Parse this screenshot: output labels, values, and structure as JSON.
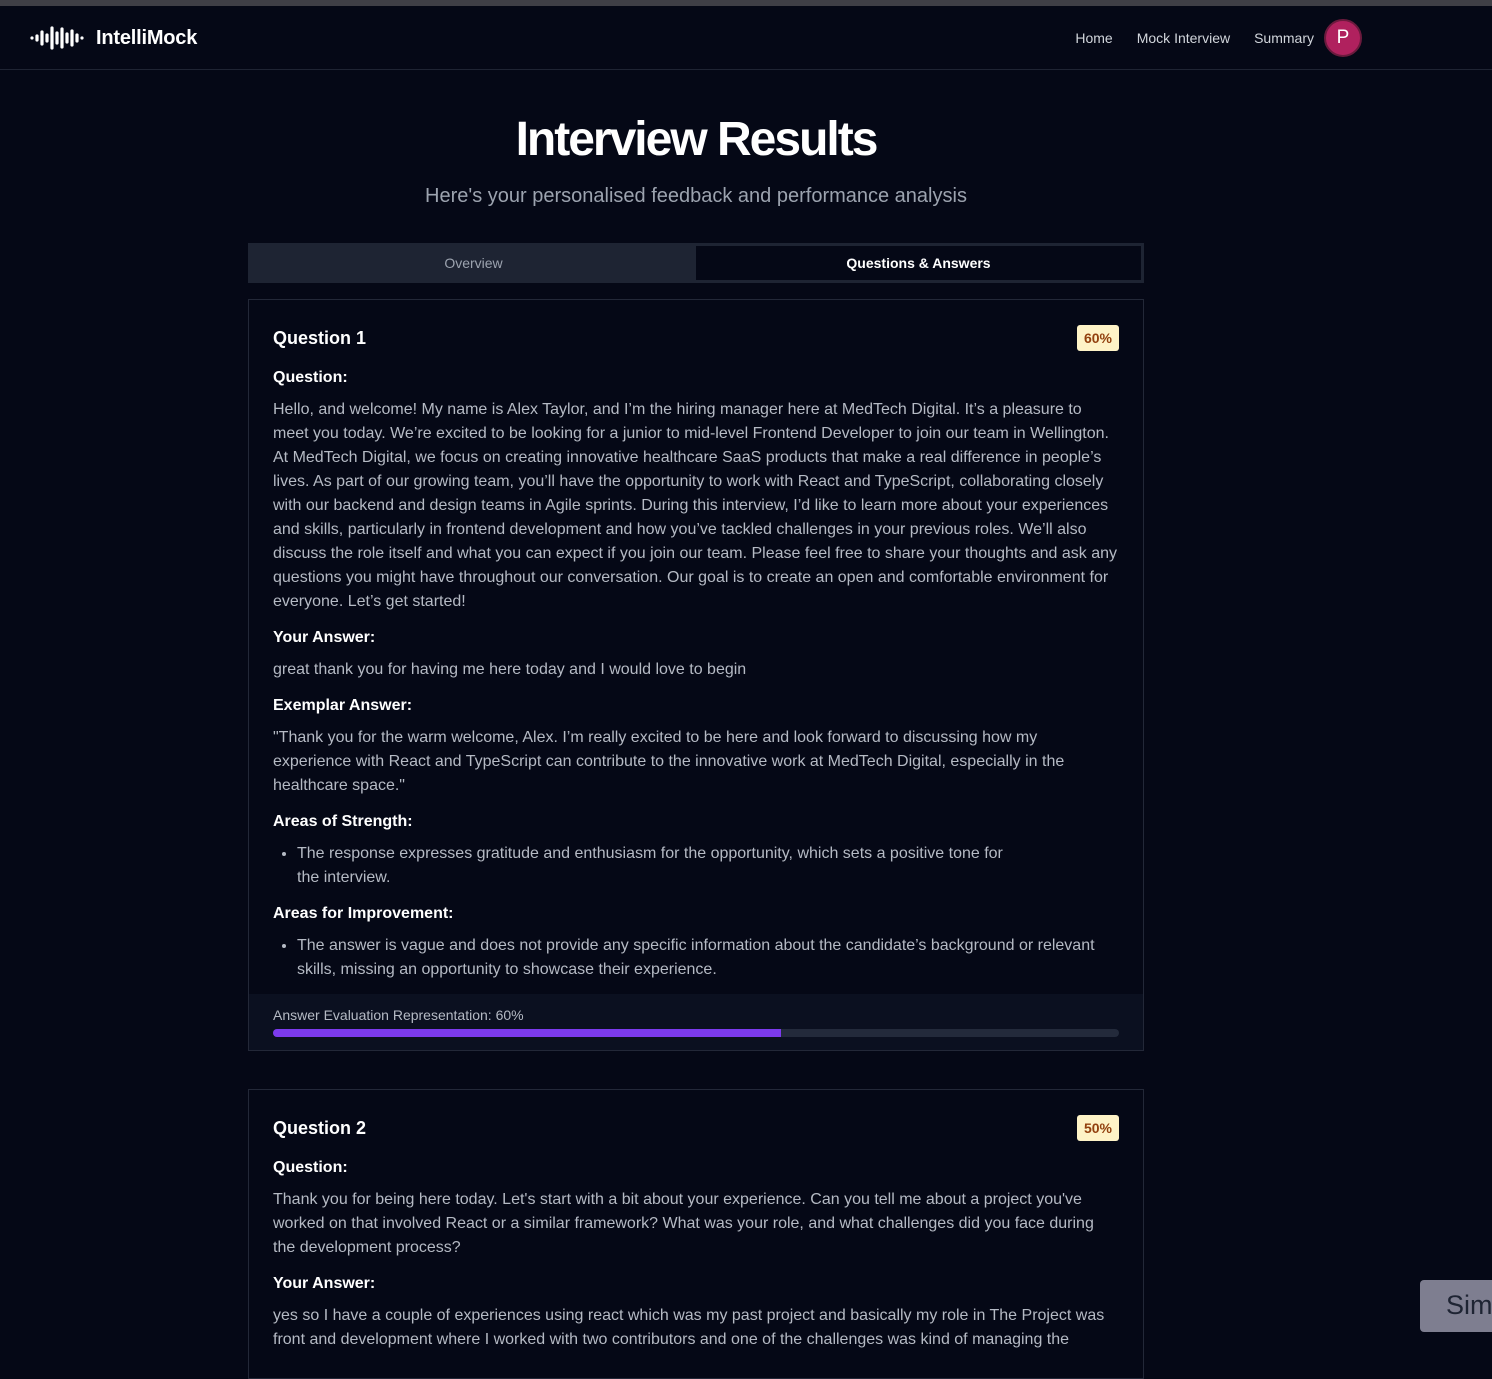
{
  "app": {
    "name": "IntelliMock"
  },
  "nav": {
    "links": [
      "Home",
      "Mock Interview",
      "Summary"
    ],
    "avatar_initial": "P"
  },
  "page": {
    "title": "Interview Results",
    "subtitle": "Here's your personalised feedback and performance analysis"
  },
  "tabs": [
    {
      "label": "Overview",
      "active": false
    },
    {
      "label": "Questions & Answers",
      "active": true
    }
  ],
  "labels": {
    "question": "Question:",
    "your_answer": "Your Answer:",
    "exemplar": "Exemplar Answer:",
    "strengths": "Areas of Strength:",
    "improvements": "Areas for Improvement:"
  },
  "questions": [
    {
      "title": "Question 1",
      "score": "60%",
      "score_value": 60,
      "question": "Hello, and welcome! My name is Alex Taylor, and I’m the hiring manager here at MedTech Digital. It’s a pleasure to meet you today. We’re excited to be looking for a junior to mid-level Frontend Developer to join our team in Wellington. At MedTech Digital, we focus on creating innovative healthcare SaaS products that make a real difference in people’s lives. As part of our growing team, you’ll have the opportunity to work with React and TypeScript, collaborating closely with our backend and design teams in Agile sprints. During this interview, I’d like to learn more about your experiences and skills, particularly in frontend development and how you’ve tackled challenges in your previous roles. We’ll also discuss the role itself and what you can expect if you join our team. Please feel free to share your thoughts and ask any questions you might have throughout our conversation. Our goal is to create an open and comfortable environment for everyone. Let’s get started!",
      "answer": "great thank you for having me here today and I would love to begin",
      "exemplar": "\"Thank you for the warm welcome, Alex. I’m really excited to be here and look forward to discussing how my experience with React and TypeScript can contribute to the innovative work at MedTech Digital, especially in the healthcare space.\"",
      "strengths": [
        "The response expresses gratitude and enthusiasm for the opportunity, which sets a positive tone for the interview."
      ],
      "improvements": [
        "The answer is vague and does not provide any specific information about the candidate’s background or relevant skills, missing an opportunity to showcase their experience."
      ],
      "eval_label": "Answer Evaluation Representation: 60%"
    },
    {
      "title": "Question 2",
      "score": "50%",
      "score_value": 50,
      "question": "Thank you for being here today. Let's start with a bit about your experience. Can you tell me about a project you've worked on that involved React or a similar framework? What was your role, and what challenges did you face during the development process?",
      "answer": "yes so I have a couple of experiences using react which was my past project and basically my role in The Project was front and development where I worked with two contributors and one of the challenges was kind of managing the"
    }
  ],
  "floating_button": {
    "label": "Sim"
  },
  "colors": {
    "background": "#050816",
    "accent": "#7c3aed",
    "badge_bg": "#fef3c7",
    "badge_text": "#92400e",
    "avatar": "#b0215e"
  }
}
